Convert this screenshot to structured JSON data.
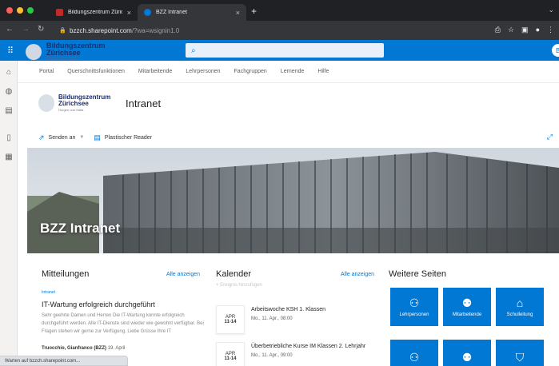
{
  "browser": {
    "tabs": [
      {
        "title": "Bildungszentrum Zürichsee Bi",
        "close": "×",
        "active": false
      },
      {
        "title": "BZZ Intranet",
        "close": "×",
        "active": true
      }
    ],
    "new_tab": "+",
    "url_host": "bzzch.sharepoint.com",
    "url_path": "/?wa=wsignin1.0",
    "status_text": "Warten auf bzzch.sharepoint.com...",
    "colors": {
      "tabbar": "#202124",
      "toolbar": "#35363a",
      "red": "#ff5f57",
      "yellow": "#febc2e",
      "green": "#28c840"
    }
  },
  "suitebar": {
    "logo_line1": "Bildungszentrum",
    "logo_line2": "Zürichsee",
    "logo_sub": "Horgen und Stäfa",
    "accent": "#0078d4"
  },
  "hubnav": {
    "items": [
      "Portal",
      "Querschnittsfunktionen",
      "Mitarbeitende",
      "Lehrpersonen",
      "Fachgruppen",
      "Lernende",
      "Hilfe"
    ]
  },
  "site": {
    "logo_line1": "Bildungszentrum",
    "logo_line2": "Zürichsee",
    "logo_sub": "Horgen und Stäfa",
    "title": "Intranet"
  },
  "commandbar": {
    "send_label": "Senden an",
    "reader_label": "Plastischer Reader"
  },
  "hero": {
    "title": "BZZ Intranet"
  },
  "news": {
    "title": "Mitteilungen",
    "see_all": "Alle anzeigen",
    "item": {
      "tag": "Intranet",
      "title": "IT-Wartung erfolgreich durchgeführt",
      "body": "Sehr geehrte Damen und Herren Die IT-Wartung konnte erfolgreich durchgeführt werden. Alle IT-Dienste sind wieder wie gewohnt verfügbar. Bei Fragen stehen wir gerne zur Verfügung. Liebe Grüsse Ihre IT",
      "author": "Truocchio, Gianfranco (BZZ)",
      "date": "19. April"
    }
  },
  "calendar": {
    "title": "Kalender",
    "see_all": "Alle anzeigen",
    "add_event": "+ Ereignis hinzufügen",
    "events": [
      {
        "month": "APR",
        "days": "11-14",
        "title": "Arbeitswoche KSH 1. Klassen",
        "time": "Mo., 11. Apr., 08:00"
      },
      {
        "month": "APR",
        "days": "11-14",
        "title": "Überbetriebliche Kurse IM Klassen 2. Lehrjahr",
        "time": "Mo., 11. Apr., 09:00"
      }
    ]
  },
  "quicklinks": {
    "title": "Weitere Seiten",
    "tiles": [
      {
        "label": "Lehrpersonen",
        "icon": "people-teach-icon"
      },
      {
        "label": "Mitarbeitende",
        "icon": "people-group-icon"
      },
      {
        "label": "Schulleitung",
        "icon": "people-home-icon"
      },
      {
        "label": "",
        "icon": "people-list-icon"
      },
      {
        "label": "",
        "icon": "people-settings-icon"
      },
      {
        "label": "",
        "icon": "graduation-icon"
      }
    ]
  }
}
